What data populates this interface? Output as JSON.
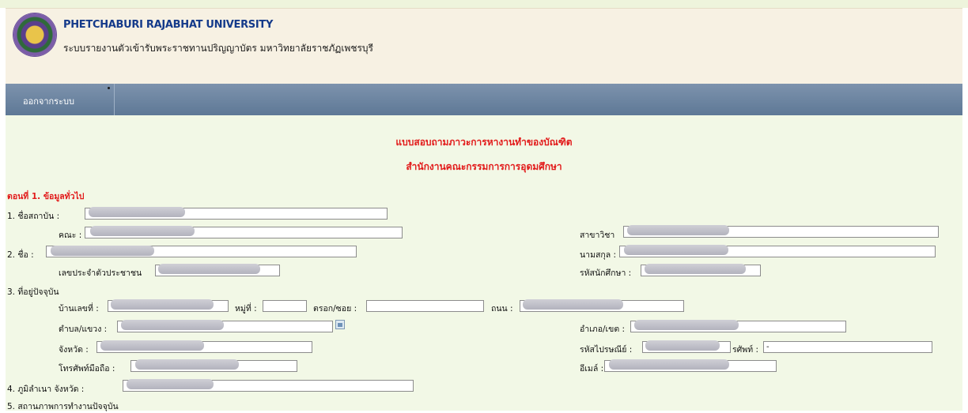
{
  "header": {
    "university": "PHETCHABURI RAJABHAT UNIVERSITY",
    "system_name": "ระบบรายงานตัวเข้ารับพระราชทานปริญญาบัตร  มหาวิทยาลัยราชภัฏเพชรบุรี"
  },
  "nav": {
    "logout": "ออกจากระบบ"
  },
  "form": {
    "title": "แบบสอบถามภาวะการหางานทำของบัณฑิต",
    "subtitle": "สำนักงานคณะกรรมการการอุดมศึกษา",
    "section1": "ตอนที่ 1. ข้อมูลทั่วไป",
    "labels": {
      "institution": "1. ชื่อสถาบัน :",
      "faculty": "คณะ :",
      "major": "สาขาวิชา",
      "name": "2. ชื่อ :",
      "surname": "นามสกุล :",
      "id_card": "เลขประจำตัวประชาชน",
      "student_id": "รหัสนักศึกษา :",
      "address": "3. ที่อยู่ปัจจุบัน",
      "house_no": "บ้านเลขที่ :",
      "moo": "หมู่ที่ :",
      "soi": "ตรอก/ซอย :",
      "road": "ถนน :",
      "subdistrict": "ตำบล/แขวง :",
      "district": "อำเภอ/เขต :",
      "province": "จังหวัด :",
      "postcode": "รหัสไปรษณีย์ :",
      "phone": "รศัพท์ :",
      "mobile": "โทรศัพท์มือถือ :",
      "email": "อีเมล์ :",
      "birthplace": "4. ภูมิลำเนา จังหวัด :",
      "employment": "5. สถานภาพการทำงานปัจจุบัน"
    },
    "values": {
      "phone": "-"
    }
  }
}
